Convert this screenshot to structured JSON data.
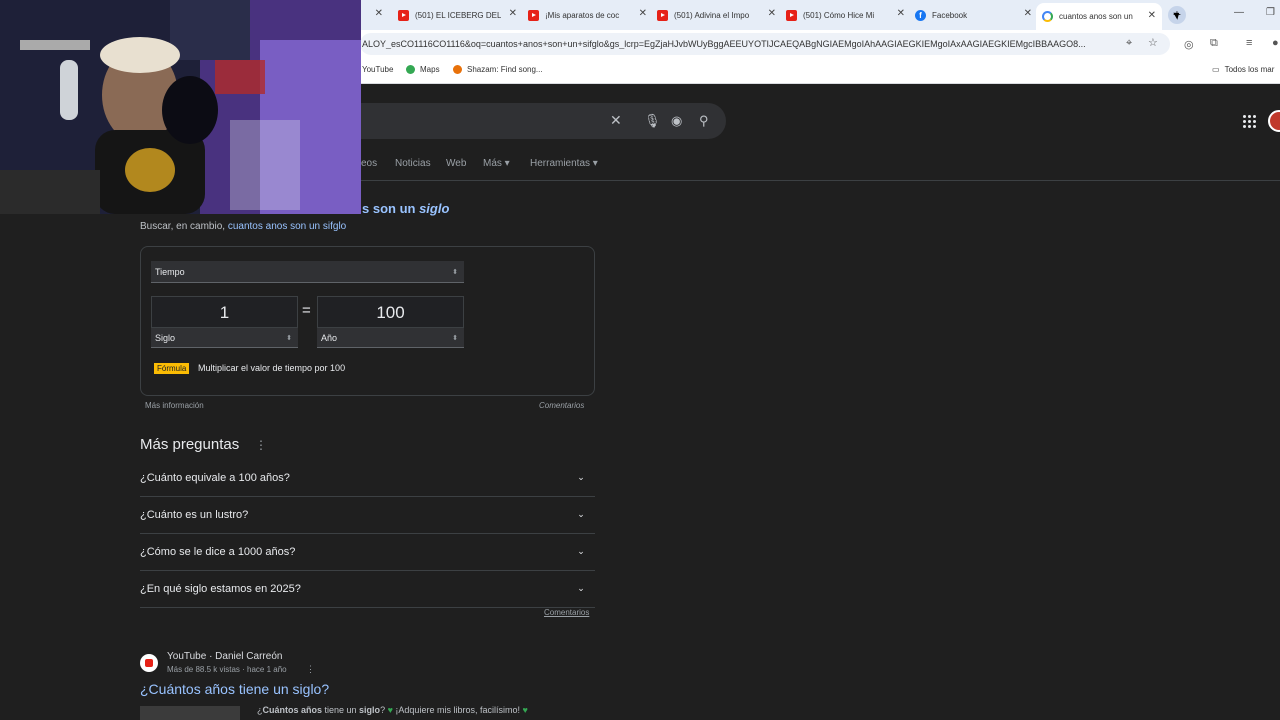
{
  "browser": {
    "tabs": [
      {
        "title": "",
        "icon": "none"
      },
      {
        "title": "(501) EL ICEBERG DEL",
        "icon": "youtube"
      },
      {
        "title": "¡Mis aparatos de coc",
        "icon": "youtube"
      },
      {
        "title": "(501) Adivina el Impo",
        "icon": "youtube"
      },
      {
        "title": "(501) Cómo Hice Mi",
        "icon": "youtube"
      },
      {
        "title": "Facebook",
        "icon": "facebook"
      },
      {
        "title": "cuantos anos son un",
        "icon": "google",
        "active": true
      }
    ],
    "new_tab_label": "+",
    "url": "ALOY_esCO1116CO1116&oq=cuantos+anos+son+un+sifglo&gs_lcrp=EgZjaHJvbWUyBggAEEUYOTIJCAEQABgNGIAEMgoIAhAAGIAEGKIEMgoIAxAAGIAEGKIEMgcIBBAAGO8...",
    "bookmarks": [
      {
        "label": "YouTube",
        "icon": "none"
      },
      {
        "label": "Maps",
        "icon": "maps-pin"
      },
      {
        "label": "Shazam: Find song...",
        "icon": "shazam"
      }
    ],
    "bookmarks_all": "Todos los mar"
  },
  "search": {
    "nav_tabs": [
      "eos",
      "Noticias",
      "Web",
      "Más ▾",
      "Herramientas ▾"
    ]
  },
  "spelling": {
    "heading_prefix": "s son un ",
    "heading_italic": "siglo",
    "alt_prefix": "Buscar, en cambio, ",
    "alt_link": "cuantos anos son un sifglo"
  },
  "converter": {
    "category": "Tiempo",
    "from_value": "1",
    "to_value": "100",
    "from_unit": "Siglo",
    "to_unit": "Año",
    "equals": "=",
    "formula_label": "Fórmula",
    "formula_text": "Multiplicar el valor de tiempo por 100",
    "more_info": "Más información",
    "feedback": "Comentarios"
  },
  "paa": {
    "title": "Más preguntas",
    "menu": "⋮",
    "questions": [
      "¿Cuánto equivale a 100 años?",
      "¿Cuánto es un lustro?",
      "¿Cómo se le dice a 1000 años?",
      "¿En qué siglo estamos en 2025?"
    ],
    "feedback": "Comentarios"
  },
  "video_result": {
    "source": "YouTube · Daniel Carreón",
    "meta": "Más de 88.5 k vistas · hace 1 año",
    "more": "⋮",
    "title": "¿Cuántos años tiene un siglo?",
    "snippet_bold_1": "Cuántos años",
    "snippet_mid": " tiene un ",
    "snippet_bold_2": "siglo",
    "snippet_rest": "? ",
    "snippet_tail": " ¡Adquiere mis libros, facilísimo! ",
    "snippet_open": "¿"
  }
}
